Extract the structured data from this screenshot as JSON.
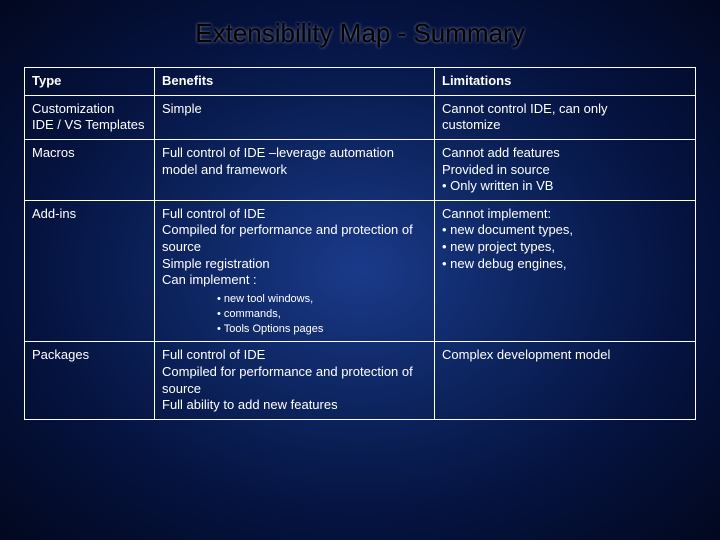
{
  "title": "Extensibility Map - Summary",
  "headers": {
    "c1": "Type",
    "c2": "Benefits",
    "c3": "Limitations"
  },
  "rows": {
    "r1": {
      "type_l1": "Customization",
      "type_l2": "IDE / VS Templates",
      "benefits": "Simple",
      "limits_l1": "Cannot control IDE, can only",
      "limits_l2": "customize"
    },
    "r2": {
      "type": "Macros",
      "benefits_l1": "Full control of IDE –leverage automation",
      "benefits_l2": "model and framework",
      "limits_l1": "Cannot add features",
      "limits_l2": "Provided in source",
      "limits_l3": "• Only written in VB"
    },
    "r3": {
      "type": "Add-ins",
      "benefits_l1": "Full control of IDE",
      "benefits_l2": "Compiled for performance and protection of",
      "benefits_l3": "source",
      "benefits_l4": "Simple registration",
      "benefits_l5": "Can implement :",
      "sub1": "• new tool windows,",
      "sub2": "• commands,",
      "sub3": "• Tools Options pages",
      "limits_l1": "Cannot implement:",
      "limits_l2": "• new document types,",
      "limits_l3": "• new project types,",
      "limits_l4": "• new debug engines,"
    },
    "r4": {
      "type": "Packages",
      "benefits_l1": "Full control of IDE",
      "benefits_l2": "Compiled for performance and protection of",
      "benefits_l3": "source",
      "benefits_l4": "Full ability to add new features",
      "limits": "Complex development model"
    }
  }
}
